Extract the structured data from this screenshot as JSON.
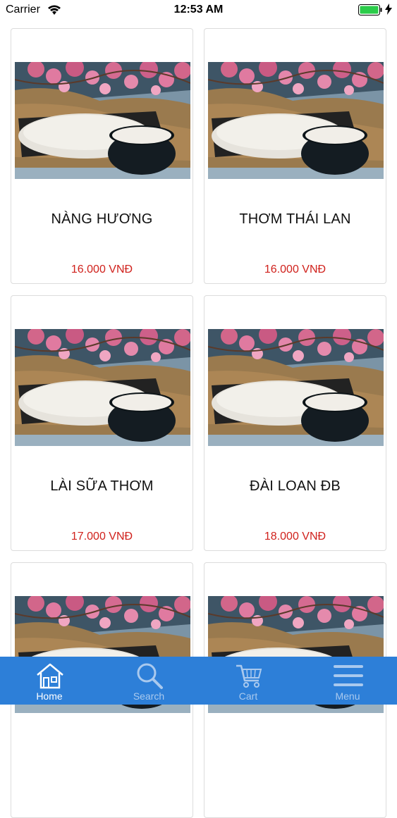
{
  "status_bar": {
    "carrier": "Carrier",
    "time": "12:53 AM",
    "battery_color": "#2bcc4a"
  },
  "products": [
    {
      "name": "NÀNG HƯƠNG",
      "price": "16.000 VNĐ"
    },
    {
      "name": "THƠM THÁI LAN",
      "price": "16.000 VNĐ"
    },
    {
      "name": "LÀI SỮA THƠM",
      "price": "17.000 VNĐ"
    },
    {
      "name": "ĐÀI LOAN ĐB",
      "price": "18.000 VNĐ"
    },
    {
      "name": "",
      "price": ""
    },
    {
      "name": "",
      "price": ""
    }
  ],
  "tab_bar": {
    "color": "#2d7fd8",
    "tabs": [
      {
        "label": "Home",
        "icon": "home-icon",
        "active": true
      },
      {
        "label": "Search",
        "icon": "search-icon",
        "active": false
      },
      {
        "label": "Cart",
        "icon": "cart-icon",
        "active": false
      },
      {
        "label": "Menu",
        "icon": "menu-icon",
        "active": false
      }
    ]
  },
  "colors": {
    "price": "#d0211c",
    "card_border": "#dcdcdc"
  }
}
